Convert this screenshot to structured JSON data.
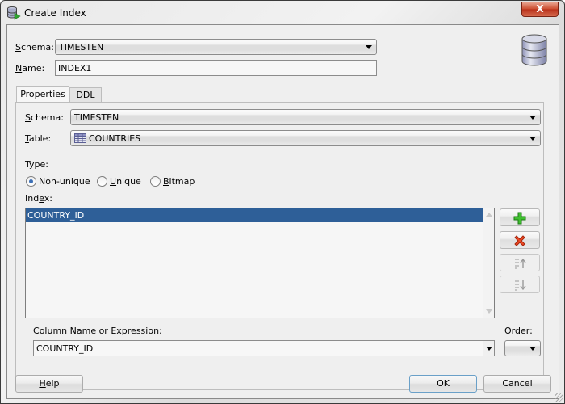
{
  "window": {
    "title": "Create Index",
    "close_label": "X"
  },
  "top": {
    "schema_label": "Schema:",
    "schema_mnemonic": "S",
    "schema_rest": "chema:",
    "schema_value": "TIMESTEN",
    "name_label": "Name:",
    "name_mnemonic": "N",
    "name_rest": "ame:",
    "name_value": "INDEX1"
  },
  "tabs": [
    {
      "label": "Properties",
      "active": true
    },
    {
      "label": "DDL",
      "active": false
    }
  ],
  "properties": {
    "schema_mnemonic": "S",
    "schema_rest": "chema:",
    "schema_value": "TIMESTEN",
    "table_mnemonic": "T",
    "table_rest": "able:",
    "table_value": "COUNTRIES",
    "table_icon": "table-grid-icon",
    "type_label": "Type:",
    "type_options": [
      {
        "label": "Non-unique",
        "checked": true
      },
      {
        "label": "Unique",
        "checked": false
      },
      {
        "label": "Bitmap",
        "checked": false
      }
    ],
    "index_label_pre": "Ind",
    "index_mnemonic": "e",
    "index_label_post": "x:",
    "index_columns": [
      "COUNTRY_ID"
    ],
    "index_selected": "COUNTRY_ID",
    "column_label_mnemonic": "C",
    "column_label_rest": "olumn Name or Expression:",
    "column_value": "COUNTRY_ID",
    "order_mnemonic": "O",
    "order_rest": "rder:",
    "order_value": ""
  },
  "side_buttons": [
    {
      "name": "add-column",
      "icon": "plus-icon",
      "enabled": true
    },
    {
      "name": "remove-column",
      "icon": "delete-x-icon",
      "enabled": true
    },
    {
      "name": "move-up",
      "icon": "move-up-icon",
      "enabled": false
    },
    {
      "name": "move-down",
      "icon": "move-down-icon",
      "enabled": false
    }
  ],
  "footer": {
    "help_mnemonic": "H",
    "help_rest": "elp",
    "ok_label": "OK",
    "cancel_label": "Cancel"
  }
}
